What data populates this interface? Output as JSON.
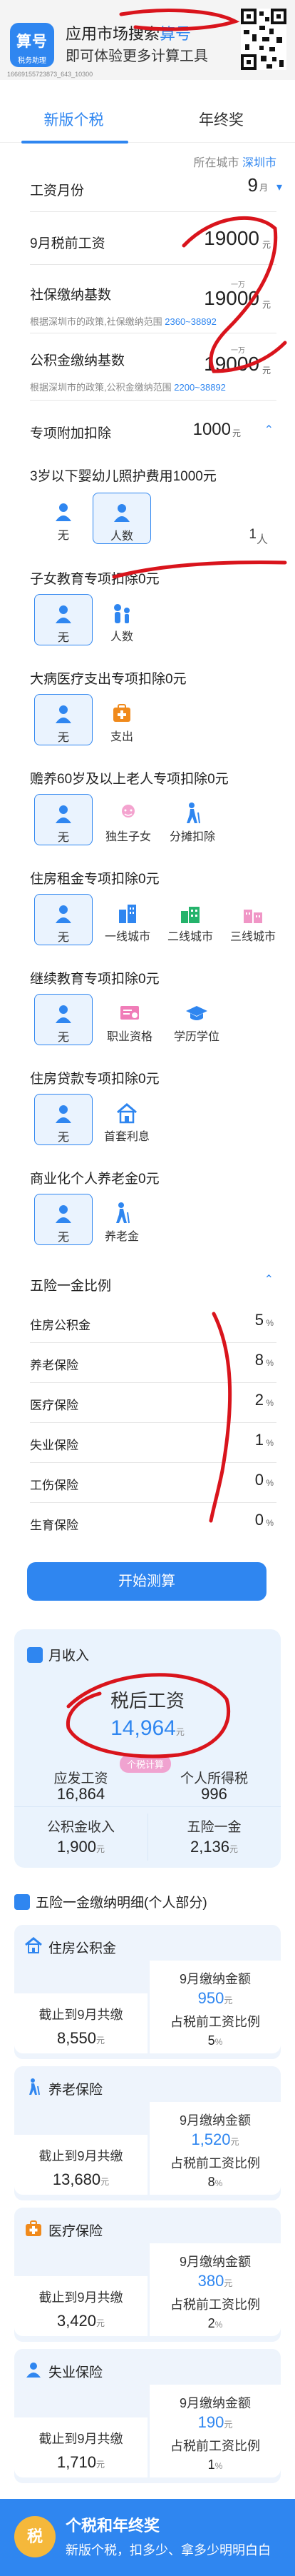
{
  "ad_header": {
    "logo_line1": "算号",
    "logo_line2": "税务助理",
    "title_prefix": "应用市场搜索",
    "title_highlight": "算号",
    "subtitle": "即可体验更多计算工具",
    "id_text": "16669155723873_643_10300"
  },
  "tabs": [
    {
      "label": "新版个税"
    },
    {
      "label": "年终奖"
    }
  ],
  "city": {
    "prefix": "所在城市",
    "name": "深圳市"
  },
  "form": {
    "salary_month": {
      "label": "工资月份",
      "value": "9",
      "unit": "月"
    },
    "pre_tax": {
      "label": "9月税前工资",
      "value": "19000",
      "unit": "元"
    },
    "social_base": {
      "label": "社保缴纳基数",
      "tag": "一万",
      "value": "19000",
      "unit": "元",
      "hint": "根据深圳市的政策,社保缴纳范围",
      "hint_link": "2360~38892"
    },
    "fund_base": {
      "label": "公积金缴纳基数",
      "tag": "一万",
      "value": "19000",
      "unit": "元",
      "hint": "根据深圳市的政策,公积金缴纳范围",
      "hint_link": "2200~38892"
    },
    "special_deduct": {
      "label": "专项附加扣除",
      "value": "1000",
      "unit": "元"
    }
  },
  "sections": {
    "infant": {
      "title": "3岁以下婴幼儿照护费用1000元",
      "opt1": "无",
      "opt2": "人数",
      "count": "1",
      "count_unit": "人"
    },
    "children": {
      "title": "子女教育专项扣除0元",
      "opt1": "无",
      "opt2": "人数"
    },
    "illness": {
      "title": "大病医疗支出专项扣除0元",
      "opt1": "无",
      "opt2": "支出"
    },
    "elderly": {
      "title": "赡养60岁及以上老人专项扣除0元",
      "opt1": "无",
      "opt2": "独生子女",
      "opt3": "分摊扣除"
    },
    "rent": {
      "title": "住房租金专项扣除0元",
      "opt1": "无",
      "opt2": "一线城市",
      "opt3": "二线城市",
      "opt4": "三线城市"
    },
    "education": {
      "title": "继续教育专项扣除0元",
      "opt1": "无",
      "opt2": "职业资格",
      "opt3": "学历学位"
    },
    "loan": {
      "title": "住房贷款专项扣除0元",
      "opt1": "无",
      "opt2": "首套利息"
    },
    "pension": {
      "title": "商业化个人养老金0元",
      "opt1": "无",
      "opt2": "养老金"
    }
  },
  "insurance": {
    "title": "五险一金比例",
    "items": [
      {
        "label": "住房公积金",
        "value": "5",
        "unit": "%"
      },
      {
        "label": "养老保险",
        "value": "8",
        "unit": "%"
      },
      {
        "label": "医疗保险",
        "value": "2",
        "unit": "%"
      },
      {
        "label": "失业保险",
        "value": "1",
        "unit": "%"
      },
      {
        "label": "工伤保险",
        "value": "0",
        "unit": "%"
      },
      {
        "label": "生育保险",
        "value": "0",
        "unit": "%"
      }
    ]
  },
  "start_button": "开始测算",
  "result": {
    "heading": "月收入",
    "after_tax_label": "税后工资",
    "after_tax_value": "14,964",
    "unit": "元",
    "badge": "个税计算",
    "tl_label": "应发工资",
    "tl_value": "16,864",
    "tr_label": "个人所得税",
    "tr_value": "996",
    "bl_label": "公积金收入",
    "bl_value": "1,900",
    "br_label": "五险一金",
    "br_value": "2,136"
  },
  "detail": {
    "heading": "五险一金缴纳明细(个人部分)",
    "cards": [
      {
        "title": "住房公积金",
        "left_label": "截止到9月共缴",
        "left_value": "8,550",
        "right_label": "9月缴纳金额",
        "right_value": "950",
        "ratio_label": "占税前工资比例",
        "ratio_value": "5"
      },
      {
        "title": "养老保险",
        "left_label": "截止到9月共缴",
        "left_value": "13,680",
        "right_label": "9月缴纳金额",
        "right_value": "1,520",
        "ratio_label": "占税前工资比例",
        "ratio_value": "8"
      },
      {
        "title": "医疗保险",
        "left_label": "截止到9月共缴",
        "left_value": "3,420",
        "right_label": "9月缴纳金额",
        "right_value": "380",
        "ratio_label": "占税前工资比例",
        "ratio_value": "2"
      },
      {
        "title": "失业保险",
        "left_label": "截止到9月共缴",
        "left_value": "1,710",
        "right_label": "9月缴纳金额",
        "right_value": "190",
        "ratio_label": "占税前工资比例",
        "ratio_value": "1"
      }
    ],
    "unit": "元",
    "pct": "%"
  },
  "footer_ad": {
    "icon": "税",
    "title": "个税和年终奖",
    "subtitle": "新版个税，扣多少、拿多少明明白白"
  },
  "colors": {
    "accent": "#2f86f0",
    "scribble": "#d9141c",
    "badge": "#f0a3d0"
  }
}
